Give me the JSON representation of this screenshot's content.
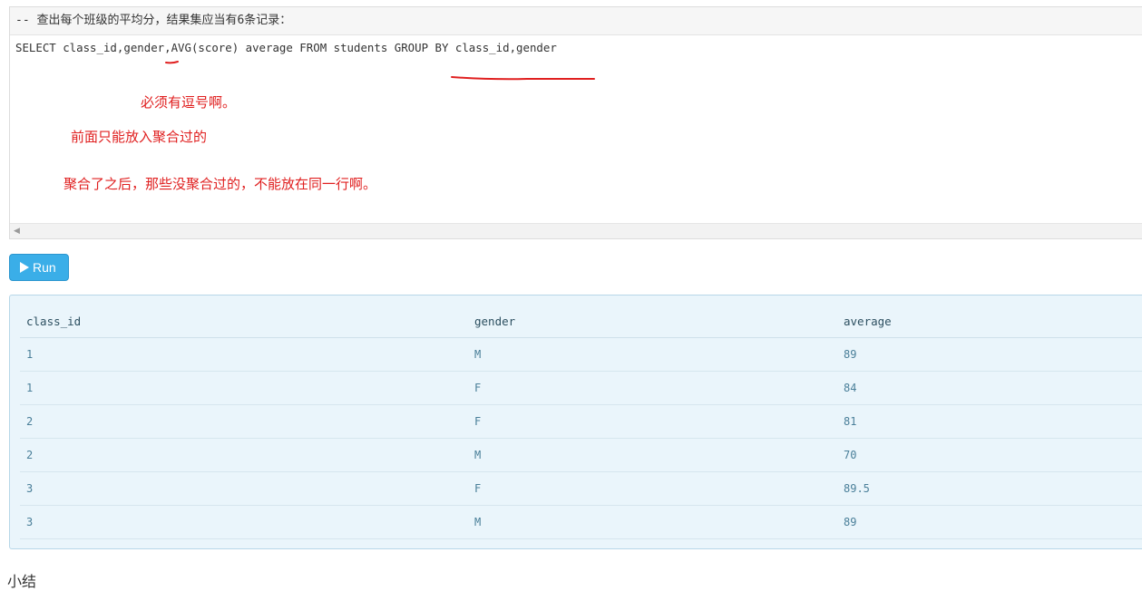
{
  "editor": {
    "comment": "-- 查出每个班级的平均分，结果集应当有6条记录：",
    "code": "SELECT class_id,gender,AVG(score) average FROM students GROUP BY class_id,gender"
  },
  "annotations": {
    "note_1": "必须有逗号啊。",
    "note_2": "前面只能放入聚合过的",
    "note_3": "聚合了之后，那些没聚合过的，不能放在同一行啊。",
    "color": "#e02020"
  },
  "run_button": {
    "label": "Run",
    "icon": "play-icon",
    "color": "#3aaee8"
  },
  "result": {
    "columns": [
      "class_id",
      "gender",
      "average"
    ],
    "rows": [
      [
        "1",
        "M",
        "89"
      ],
      [
        "1",
        "F",
        "84"
      ],
      [
        "2",
        "F",
        "81"
      ],
      [
        "2",
        "M",
        "70"
      ],
      [
        "3",
        "F",
        "89.5"
      ],
      [
        "3",
        "M",
        "89"
      ]
    ]
  },
  "footer": {
    "text": "小结"
  }
}
